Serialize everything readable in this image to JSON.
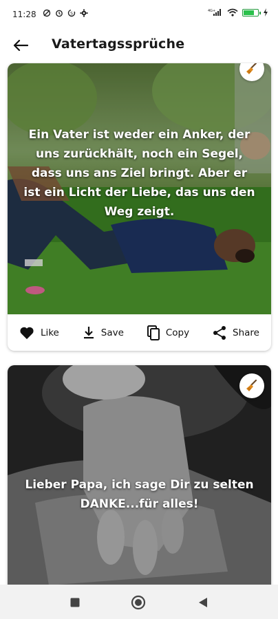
{
  "status_bar": {
    "time": "11:28",
    "network": "4G+",
    "battery_level": 0.8,
    "icons": [
      "vpn-icon",
      "alarm-icon",
      "data-saver-icon",
      "settings-icon",
      "signal-icon",
      "wifi-icon",
      "battery-icon",
      "charging-icon"
    ]
  },
  "app_bar": {
    "title": "Vatertagssprüche",
    "back_icon": "arrow-left-icon"
  },
  "cards": [
    {
      "quote": "Ein Vater ist weder ein Anker, der uns zurückhält, noch ein Segel, dass uns ans Ziel bringt. Aber er ist ein Licht der Liebe, das uns den Weg zeigt.",
      "badge_icon": "broom-icon",
      "image": "father-lying-on-grass-with-child",
      "actions": [
        {
          "label": "Like",
          "icon": "heart-icon"
        },
        {
          "label": "Save",
          "icon": "download-icon"
        },
        {
          "label": "Copy",
          "icon": "copy-icon"
        },
        {
          "label": "Share",
          "icon": "share-icon"
        }
      ]
    },
    {
      "quote": "Lieber Papa, ich sage Dir zu selten DANKE...für alles!",
      "badge_icon": "broom-icon",
      "image": "baby-hand-on-father-hand-bw"
    }
  ],
  "nav_bar": {
    "buttons": [
      "recents-square-icon",
      "home-circle-icon",
      "back-triangle-icon"
    ]
  },
  "colors": {
    "battery_green": "#2bc14c",
    "badge_orange": "#e0891c",
    "nav_background": "#f2f2f2"
  }
}
